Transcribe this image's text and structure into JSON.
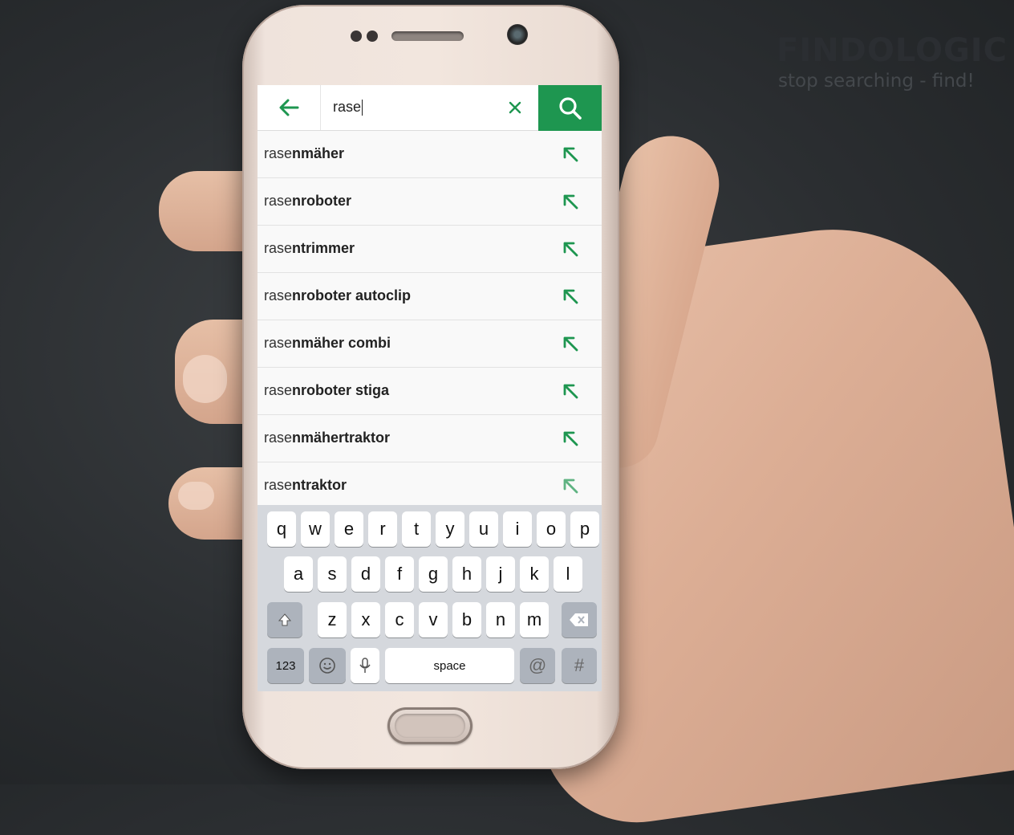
{
  "brand": {
    "logo": "FINDOLOGIC",
    "tagline": "stop searching - find!"
  },
  "search": {
    "query": "rase",
    "back_label": "back",
    "accent_color": "#1e9650"
  },
  "suggestions": [
    {
      "prefix": "rase",
      "completion": "nmäher"
    },
    {
      "prefix": "rase",
      "completion": "nroboter"
    },
    {
      "prefix": "rase",
      "completion": "ntrimmer"
    },
    {
      "prefix": "rase",
      "completion": "nroboter autoclip"
    },
    {
      "prefix": "rase",
      "completion": "nmäher combi"
    },
    {
      "prefix": "rase",
      "completion": "nroboter stiga"
    },
    {
      "prefix": "rase",
      "completion": "nmähertraktor"
    },
    {
      "prefix": "rase",
      "completion": "ntraktor"
    }
  ],
  "keyboard": {
    "row1": [
      "q",
      "w",
      "e",
      "r",
      "t",
      "y",
      "u",
      "i",
      "o",
      "p"
    ],
    "row2": [
      "a",
      "s",
      "d",
      "f",
      "g",
      "h",
      "j",
      "k",
      "l"
    ],
    "row3": [
      "z",
      "x",
      "c",
      "v",
      "b",
      "n",
      "m"
    ],
    "numbers_label": "123",
    "space_label": "space",
    "at_label": "@",
    "hash_label": "#"
  }
}
